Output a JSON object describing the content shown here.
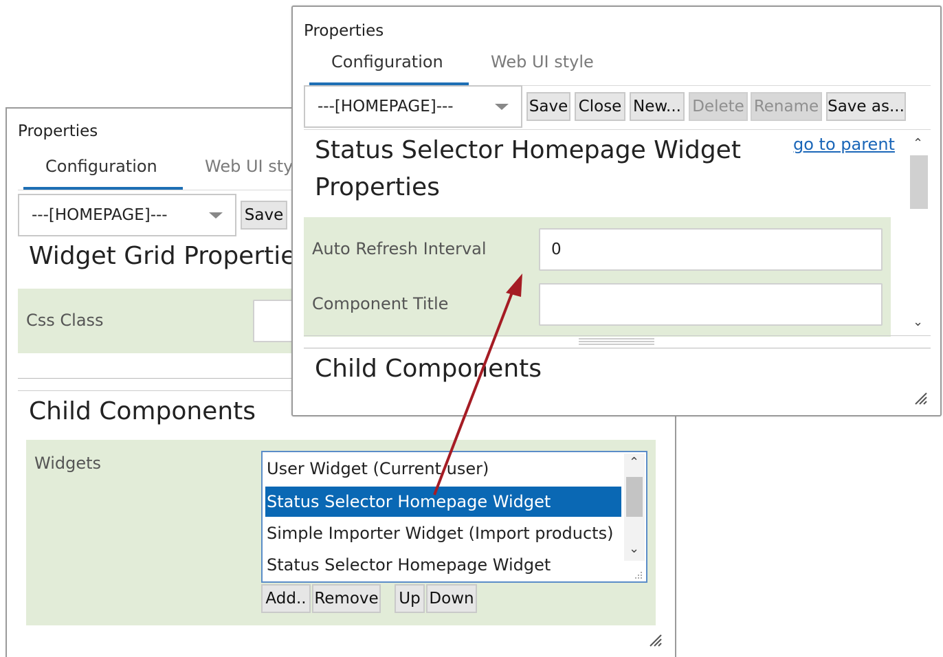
{
  "back_panel": {
    "title": "Properties",
    "tabs": [
      {
        "label": "Configuration",
        "active": true
      },
      {
        "label": "Web UI sty",
        "active": false
      }
    ],
    "select_value": "---[HOMEPAGE]---",
    "save_label": "Save",
    "heading": "Widget Grid Propertie",
    "css_class_label": "Css Class",
    "child_heading": "Child Components",
    "widgets_label": "Widgets",
    "widgets_list": [
      {
        "label": "User Widget (Current user)",
        "selected": false
      },
      {
        "label": "Status Selector Homepage Widget",
        "selected": true
      },
      {
        "label": "Simple Importer Widget (Import products)",
        "selected": false
      },
      {
        "label": "Status Selector Homepage Widget",
        "selected": false
      }
    ],
    "list_buttons": {
      "add": "Add..",
      "remove": "Remove",
      "up": "Up",
      "down": "Down"
    }
  },
  "front_panel": {
    "title": "Properties",
    "tabs": [
      {
        "label": "Configuration",
        "active": true
      },
      {
        "label": "Web UI style",
        "active": false
      }
    ],
    "select_value": "---[HOMEPAGE]---",
    "toolbar": {
      "save": "Save",
      "close": "Close",
      "new": "New...",
      "delete": "Delete",
      "rename": "Rename",
      "save_as": "Save as..."
    },
    "heading_line1": "Status Selector Homepage Widget",
    "heading_line2": "Properties",
    "go_to_parent": "go to parent",
    "fields": {
      "auto_refresh_label": "Auto Refresh Interval",
      "auto_refresh_value": "0",
      "component_title_label": "Component Title",
      "component_title_value": ""
    },
    "child_heading": "Child Components"
  },
  "colors": {
    "accent": "#1e6fb5",
    "selection": "#0a68b4",
    "form_background": "#e2ecd8",
    "arrow": "#a51c24",
    "link": "#1a66b8"
  },
  "icons": [
    "dropdown-caret-icon",
    "scroll-up-icon",
    "scroll-down-icon",
    "resize-grip-icon",
    "annotation-arrow"
  ]
}
